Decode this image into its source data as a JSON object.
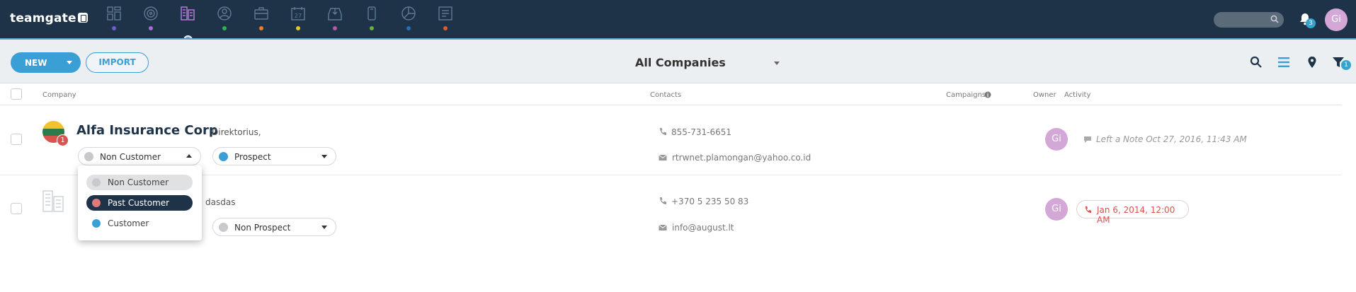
{
  "app": {
    "logo_text": "teamgate"
  },
  "nav": {
    "icons": [
      {
        "name": "dashboard-icon",
        "dot": "#6c5fd6"
      },
      {
        "name": "target-icon",
        "dot": "#a86ad6"
      },
      {
        "name": "companies-icon",
        "dot": null,
        "active": true
      },
      {
        "name": "people-icon",
        "dot": "#2db34a"
      },
      {
        "name": "deals-icon",
        "dot": "#f07c2a"
      },
      {
        "name": "calendar-icon",
        "dot": "#e6c52b",
        "label": "27"
      },
      {
        "name": "inbox-icon",
        "dot": "#b35aa6"
      },
      {
        "name": "phone-icon",
        "dot": "#66b23a"
      },
      {
        "name": "reports-icon",
        "dot": "#2a6bb3"
      },
      {
        "name": "forms-icon",
        "dot": "#e35a2a"
      }
    ],
    "notifications_count": "3",
    "user_initials": "Gi"
  },
  "toolbar": {
    "new_label": "NEW",
    "import_label": "IMPORT",
    "view_title": "All Companies",
    "filter_count": "1"
  },
  "table": {
    "headers": {
      "company": "Company",
      "contacts": "Contacts",
      "campaigns": "Campaigns",
      "owner": "Owner",
      "activity": "Activity"
    },
    "rows": [
      {
        "name": "Alfa Insurance Corp",
        "subtext": "Direktorius,",
        "logo_badge": "1",
        "customer_status": "Non Customer",
        "prospect_status": "Prospect",
        "phone": "855-731-6651",
        "email": "rtrwnet.plamongan@yahoo.co.id",
        "owner_initials": "Gi",
        "activity": "Left a Note Oct 27, 2016, 11:43 AM"
      },
      {
        "name": "",
        "subtext": "dasdas",
        "prospect_status": "Non Prospect",
        "phone": "+370 5 235 50 83",
        "email": "info@august.lt",
        "owner_initials": "Gi",
        "activity": "Jan 6, 2014, 12:00 AM"
      }
    ]
  },
  "dropdown": {
    "options": [
      {
        "label": "Non Customer",
        "color": "#c7c9cc",
        "state": "hover"
      },
      {
        "label": "Past Customer",
        "color": "#e07a7a",
        "state": "selected"
      },
      {
        "label": "Customer",
        "color": "#3a9fd4",
        "state": "normal"
      }
    ]
  },
  "colors": {
    "topbar": "#1e3347",
    "accent": "#3a9fd4",
    "avatar": "#d3a8d6",
    "danger": "#d9534f"
  }
}
